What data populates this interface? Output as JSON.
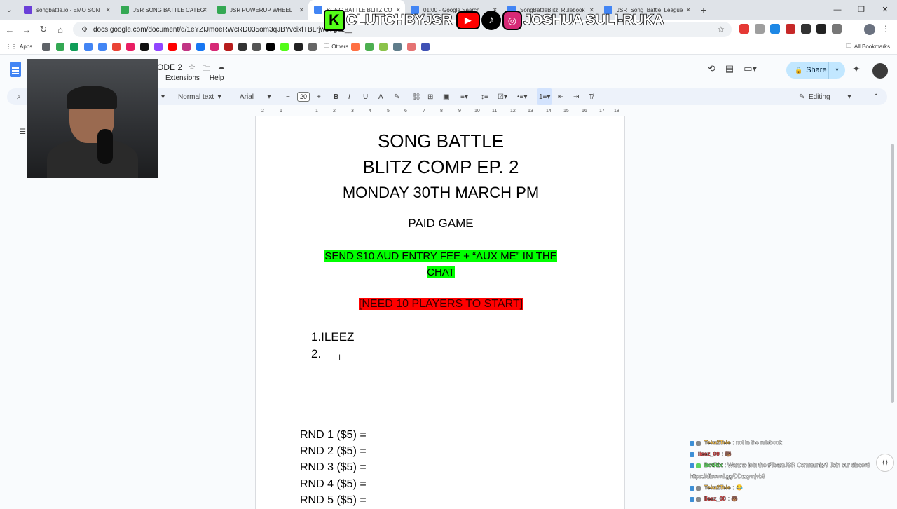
{
  "browser": {
    "tabs": [
      {
        "label": "songbattle.io - EMO SON",
        "color": "#6a3fd8",
        "active": false
      },
      {
        "label": "JSR SONG BATTLE CATEG",
        "color": "#34a853",
        "active": false
      },
      {
        "label": "JSR POWERUP WHEEL",
        "color": "#34a853",
        "active": false
      },
      {
        "label": "SONG BATTLE BLITZ CO",
        "color": "#4285f4",
        "active": true
      },
      {
        "label": "01:00 - Google Search",
        "color": "#4285f4",
        "active": false
      },
      {
        "label": "SongBattleBlitz_Rulebook",
        "color": "#4285f4",
        "active": false
      },
      {
        "label": "JSR_Song_Battle_League",
        "color": "#4285f4",
        "active": false
      }
    ],
    "url": "docs.google.com/document/d/1eYZIJmoeRWcRD035om3qJBYvcixfTBLrjwsVgbz__",
    "bookmarks": {
      "apps_label": "Apps",
      "others_label": "Others",
      "all_label": "All Bookmarks"
    }
  },
  "stream_overlay": {
    "kick_name": "CLUTCHBYJSR",
    "social_name": "JOSHUA SULI-RUKA"
  },
  "docs": {
    "title_fragment": "ODE 2",
    "menus": [
      "Extensions",
      "Help"
    ],
    "share_label": "Share",
    "toolbar": {
      "style": "Normal text",
      "font": "Arial",
      "size": "20",
      "mode": "Editing"
    },
    "ruler_marks": [
      "2",
      "1",
      "1",
      "2",
      "3",
      "4",
      "5",
      "6",
      "7",
      "8",
      "9",
      "10",
      "11",
      "12",
      "13",
      "14",
      "15",
      "16",
      "17",
      "18"
    ]
  },
  "document": {
    "heading1": "SONG BATTLE",
    "heading2": "BLITZ COMP EP. 2",
    "date": "MONDAY 30TH MARCH PM",
    "paid": "PAID GAME",
    "entry_line1": "SEND $10 AUD ENTRY FEE + “AUX ME” IN THE",
    "entry_line2": "CHAT",
    "requirement": "[NEED 10 PLAYERS TO START]",
    "players": [
      "1.ILEEZ",
      "2."
    ],
    "rounds": [
      "RND 1 ($5) =",
      "RND 2 ($5) =",
      "RND 3 ($5) =",
      "RND 4 ($5) =",
      "RND 5 ($5) ="
    ],
    "colors": {
      "green_highlight": "#00ff00",
      "red_highlight": "#ff0000"
    }
  },
  "chat": [
    {
      "user": "Teka2Tele",
      "user_color": "#e8b64c",
      "message": ": not in the rulebook"
    },
    {
      "user": "ileez_00",
      "user_color": "#d44a4a",
      "message": ":"
    },
    {
      "user": "BotRix",
      "user_color": "#5fd35f",
      "message": ": Want to join the #TeamJSR Community? Join our discord"
    },
    {
      "user": "",
      "user_color": "#ffffff",
      "message": "https://discord.gg/DDzzymjvb9"
    },
    {
      "user": "Teka2Tele",
      "user_color": "#e8b64c",
      "message": ":"
    },
    {
      "user": "ileez_00",
      "user_color": "#d44a4a",
      "message": ":"
    }
  ]
}
